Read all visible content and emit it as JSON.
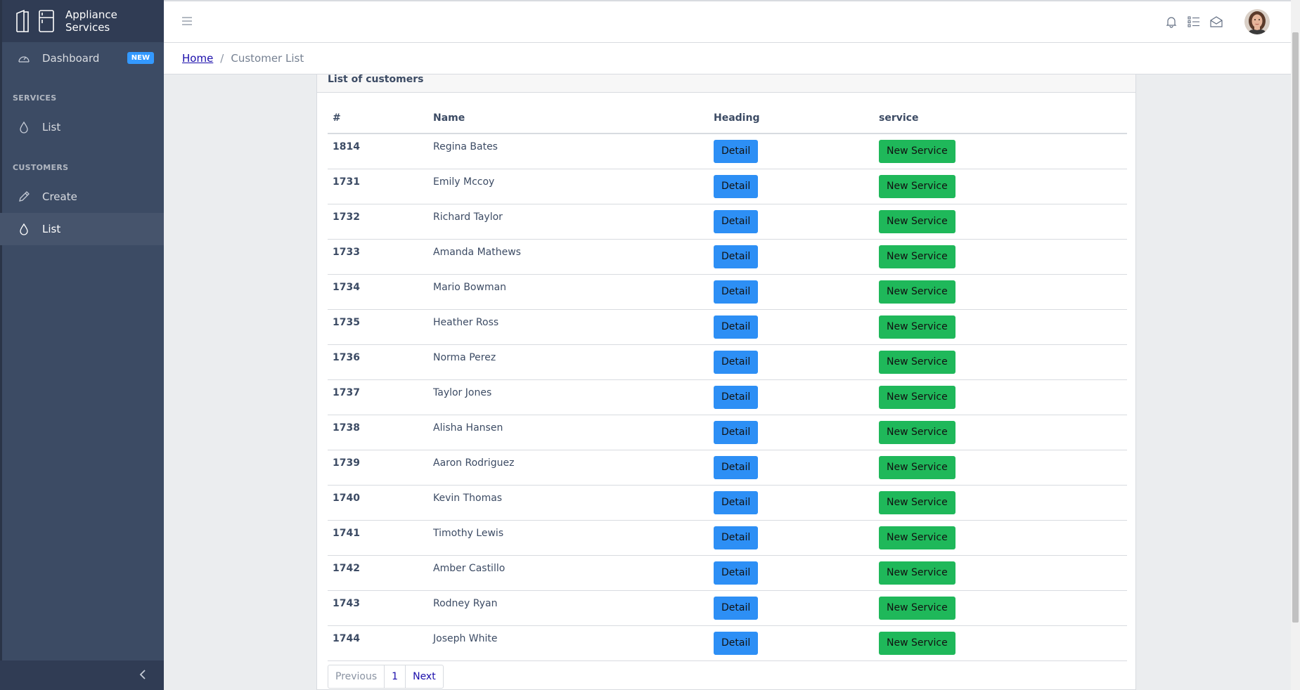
{
  "brand": {
    "title": "Appliance Services"
  },
  "sidebar": {
    "dashboard": {
      "label": "Dashboard",
      "badge": "NEW"
    },
    "sections": [
      {
        "title": "SERVICES",
        "items": [
          {
            "label": "List"
          }
        ]
      },
      {
        "title": "CUSTOMERS",
        "items": [
          {
            "label": "Create"
          },
          {
            "label": "List"
          }
        ]
      }
    ]
  },
  "breadcrumb": {
    "home": "Home",
    "separator": "/",
    "current": "Customer List"
  },
  "card": {
    "title": "List of customers"
  },
  "table": {
    "headers": [
      "#",
      "Name",
      "Heading",
      "service"
    ],
    "detail_label": "Detail",
    "service_label": "New Service",
    "rows": [
      {
        "id": "1814",
        "name": "Regina Bates"
      },
      {
        "id": "1731",
        "name": "Emily Mccoy"
      },
      {
        "id": "1732",
        "name": "Richard Taylor"
      },
      {
        "id": "1733",
        "name": "Amanda Mathews"
      },
      {
        "id": "1734",
        "name": "Mario Bowman"
      },
      {
        "id": "1735",
        "name": "Heather Ross"
      },
      {
        "id": "1736",
        "name": "Norma Perez"
      },
      {
        "id": "1737",
        "name": "Taylor Jones"
      },
      {
        "id": "1738",
        "name": "Alisha Hansen"
      },
      {
        "id": "1739",
        "name": "Aaron Rodriguez"
      },
      {
        "id": "1740",
        "name": "Kevin Thomas"
      },
      {
        "id": "1741",
        "name": "Timothy Lewis"
      },
      {
        "id": "1742",
        "name": "Amber Castillo"
      },
      {
        "id": "1743",
        "name": "Rodney Ryan"
      },
      {
        "id": "1744",
        "name": "Joseph White"
      }
    ]
  },
  "pagination": {
    "previous": "Previous",
    "page": "1",
    "next": "Next"
  },
  "colors": {
    "sidebar": "#3c4b64",
    "detail": "#2d8ff5",
    "service": "#1fb85a",
    "badge": "#3399ff"
  }
}
